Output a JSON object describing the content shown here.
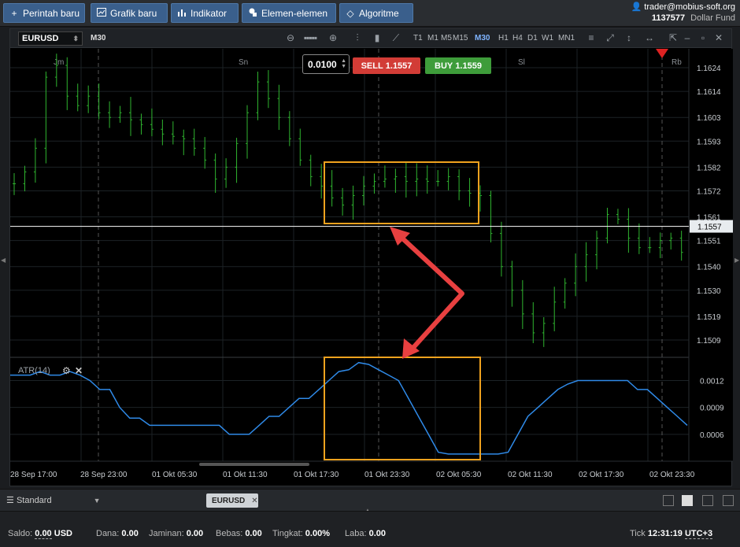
{
  "toolbar": {
    "buttons": [
      {
        "label": "Perintah baru",
        "icon": "+"
      },
      {
        "label": "Grafik baru",
        "icon": "chart"
      },
      {
        "label": "Indikator",
        "icon": "bars"
      },
      {
        "label": "Elemen-elemen",
        "icon": "shapes"
      },
      {
        "label": "Algoritme",
        "icon": "diamond"
      }
    ],
    "account_user": "trader@mobius-soft.org",
    "account_number": "1137577",
    "account_name": "Dollar Fund"
  },
  "chart_header": {
    "symbol": "EURUSD",
    "timeframe": "M30",
    "timeframes": [
      "T1",
      "M1",
      "M5",
      "M15",
      "M30",
      "H1",
      "H4",
      "D1",
      "W1",
      "MN1"
    ],
    "active_timeframe": "M30"
  },
  "trade": {
    "lot": "0.0100",
    "sell_label": "SELL",
    "sell_price": "1.1557",
    "buy_label": "BUY",
    "buy_price": "1.1559"
  },
  "indicator": {
    "name": "ATR(14)"
  },
  "chart_data": [
    {
      "type": "candlestick",
      "symbol": "EURUSD",
      "timeframe": "M30",
      "y_ticks": [
        "1.1624",
        "1.1614",
        "1.1603",
        "1.1593",
        "1.1582",
        "1.1572",
        "1.1561",
        "1.1551",
        "1.1540",
        "1.1530",
        "1.1519",
        "1.1509"
      ],
      "ylim": [
        1.1502,
        1.1632
      ],
      "current_price": "1.1557",
      "session_labels": [
        "Jm",
        "Sn",
        "Sl",
        "Rb"
      ],
      "x_ticks": [
        "28 Sep 17:00",
        "28 Sep 23:00",
        "01 Okt 05:30",
        "01 Okt 11:30",
        "01 Okt 17:30",
        "01 Okt 23:30",
        "02 Okt 05:30",
        "02 Okt 11:30",
        "02 Okt 17:30",
        "02 Okt 23:30"
      ],
      "close_path": [
        1.1575,
        1.158,
        1.159,
        1.162,
        1.1625,
        1.1612,
        1.1608,
        1.1612,
        1.1605,
        1.1603,
        1.1605,
        1.1602,
        1.16,
        1.1598,
        1.1596,
        1.1595,
        1.1594,
        1.159,
        1.1585,
        1.1577,
        1.1582,
        1.1592,
        1.1605,
        1.1618,
        1.1611,
        1.1603,
        1.1594,
        1.1585,
        1.1578,
        1.1574,
        1.1569,
        1.1566,
        1.157,
        1.1574,
        1.1576,
        1.1577,
        1.1578,
        1.1576,
        1.1577,
        1.1576,
        1.1576,
        1.1578,
        1.1572,
        1.1571,
        1.157,
        1.1554,
        1.154,
        1.153,
        1.152,
        1.1512,
        1.1516,
        1.1525,
        1.1533,
        1.154,
        1.1545,
        1.1552,
        1.1562,
        1.156,
        1.1552,
        1.1548,
        1.1548,
        1.1551,
        1.1552,
        1.1546,
        1.1547
      ]
    },
    {
      "type": "line",
      "name": "ATR(14)",
      "y_ticks": [
        "0.0012",
        "0.0009",
        "0.0006"
      ],
      "ylim": [
        0.0003,
        0.00145
      ],
      "values": [
        0.00126,
        0.00126,
        0.00126,
        0.0013,
        0.00126,
        0.00126,
        0.0013,
        0.00126,
        0.0012,
        0.0011,
        0.0011,
        0.0009,
        0.00078,
        0.00078,
        0.0007,
        0.0007,
        0.0007,
        0.0007,
        0.0007,
        0.0007,
        0.0007,
        0.0007,
        0.0006,
        0.0006,
        0.0006,
        0.0007,
        0.0008,
        0.0008,
        0.0009,
        0.001,
        0.001,
        0.0011,
        0.0012,
        0.0013,
        0.00132,
        0.0014,
        0.00138,
        0.00132,
        0.00126,
        0.0012,
        0.001,
        0.0008,
        0.0006,
        0.0004,
        0.00038,
        0.00038,
        0.00038,
        0.00038,
        0.00038,
        0.00038,
        0.0004,
        0.0006,
        0.0008,
        0.0009,
        0.001,
        0.0011,
        0.00116,
        0.0012,
        0.0012,
        0.0012,
        0.0012,
        0.0012,
        0.0012,
        0.0011,
        0.0011,
        0.001,
        0.0009,
        0.0008,
        0.0007
      ]
    }
  ],
  "bottom_tabs": {
    "layout_name": "Standard",
    "active_symbol": "EURUSD"
  },
  "status": {
    "saldo_label": "Saldo:",
    "saldo": "0.00",
    "currency": "USD",
    "dana_label": "Dana:",
    "dana": "0.00",
    "jaminan_label": "Jaminan:",
    "jaminan": "0.00",
    "bebas_label": "Bebas:",
    "bebas": "0.00",
    "tingkat_label": "Tingkat:",
    "tingkat": "0.00%",
    "laba_label": "Laba:",
    "laba": "0.00",
    "tick_label": "Tick",
    "time": "12:31:19",
    "timezone": "UTC+3"
  },
  "colors": {
    "candle_up": "#2fb52f",
    "atr_line": "#2f8ae8",
    "highlight_box": "#f0a21e",
    "arrow": "#e84040",
    "price_line": "#ffffff"
  }
}
